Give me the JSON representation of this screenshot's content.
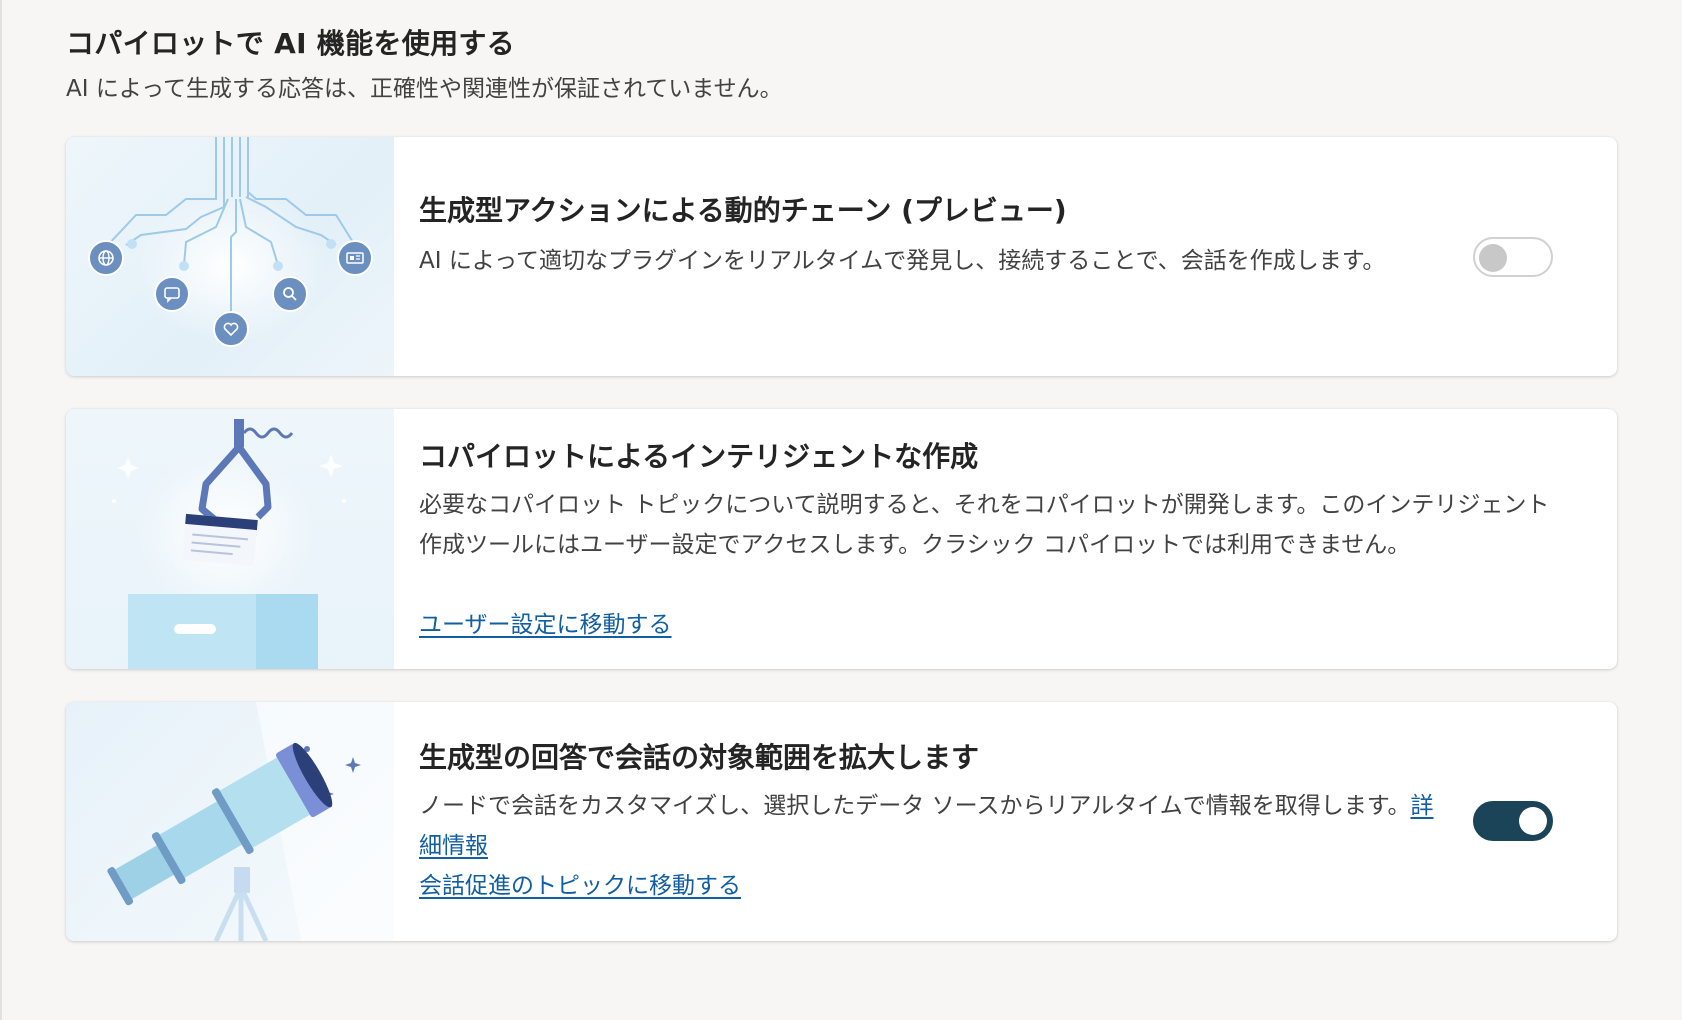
{
  "section": {
    "title": "コパイロットで AI 機能を使用する",
    "subtitle": "AI によって生成する応答は、正確性や関連性が保証されていません。"
  },
  "cards": [
    {
      "title": "生成型アクションによる動的チェーン (プレビュー)",
      "description": "AI によって適切なプラグインをリアルタイムで発見し、接続することで、会話を作成します。",
      "toggle_state": "off",
      "illustration": "plugin-network-illustration"
    },
    {
      "title": "コパイロットによるインテリジェントな作成",
      "description": "必要なコパイロット トピックについて説明すると、それをコパイロットが開発します。このインテリジェント作成ツールにはユーザー設定でアクセスします。クラシック コパイロットでは利用できません。",
      "link_label": "ユーザー設定に移動する",
      "illustration": "claw-machine-illustration"
    },
    {
      "title": "生成型の回答で会話の対象範囲を拡大します",
      "description": "ノードで会話をカスタマイズし、選択したデータ ソースからリアルタイムで情報を取得します。",
      "inline_link_label": "詳細情報",
      "link_label": "会話促進のトピックに移動する",
      "toggle_state": "on",
      "illustration": "telescope-illustration"
    }
  ],
  "icons": {
    "card1_nodes": [
      "globe-icon",
      "chat-icon",
      "heart-icon",
      "search-icon",
      "news-icon"
    ]
  },
  "colors": {
    "link": "#115ea3",
    "toggle_on": "#1b4458",
    "toggle_off_knob": "#c8c8c8",
    "page_background": "#f7f6f4"
  }
}
